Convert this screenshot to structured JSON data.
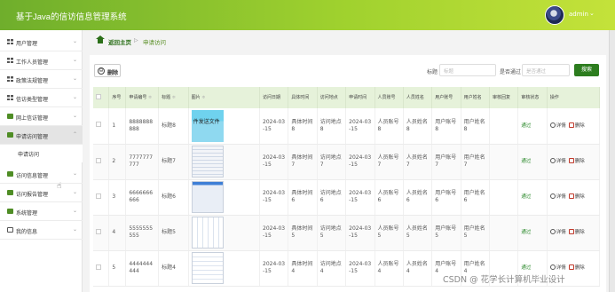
{
  "header": {
    "title": "基于Java的信访信息管理系统",
    "username": "admin",
    "user_caret": "⌄"
  },
  "sidebar": {
    "items": [
      {
        "label": "用户管理",
        "icon": "grid-icon"
      },
      {
        "label": "工作人员管理",
        "icon": "grid-icon"
      },
      {
        "label": "政策法规管理",
        "icon": "grid-icon"
      },
      {
        "label": "信访类型管理",
        "icon": "grid-icon"
      },
      {
        "label": "网上信访管理",
        "icon": "green-block-icon"
      },
      {
        "label": "申请访问管理",
        "icon": "green-block-icon",
        "expanded": true
      },
      {
        "label": "访问信息管理",
        "icon": "green-block-icon"
      },
      {
        "label": "访问报告管理",
        "icon": "green-block-icon"
      },
      {
        "label": "系统管理",
        "icon": "green-block-icon"
      },
      {
        "label": "我的信息",
        "icon": "page-icon"
      }
    ],
    "sub_item": "申请访问",
    "chevron_down": "⌄",
    "chevron_up": "⌃"
  },
  "breadcrumb": {
    "root": "返回主页",
    "separator": "▷",
    "current": "申请访问"
  },
  "toolbar": {
    "delete_label": "删除",
    "delete_icon": "⊖",
    "filter1_label": "标题",
    "filter1_placeholder": "标题",
    "filter2_label": "是否通过",
    "filter2_placeholder": "是否通过",
    "search_label": "搜索"
  },
  "table": {
    "columns": [
      "",
      "序号",
      "申请编号",
      "标题",
      "图片",
      "访问日期",
      "具体时间",
      "访问地点",
      "申请时间",
      "人员账号",
      "人员姓名",
      "用户账号",
      "用户姓名",
      "审核回复",
      "审核状态",
      "操作"
    ],
    "sort_mark": "≑",
    "rows": [
      {
        "index": "1",
        "code": "8888888888",
        "title": "标题8",
        "picture": "pic-1",
        "picture_text": "件发送文件",
        "date": "2024-03-15",
        "time": "具体时间8",
        "place": "访问地点8",
        "apply_time": "2024-03-15",
        "staff_account": "人员账号8",
        "staff_name": "人员姓名8",
        "user_account": "用户账号8",
        "user_name": "用户姓名8",
        "reply": "",
        "status": "通过"
      },
      {
        "index": "2",
        "code": "7777777777",
        "title": "标题7",
        "picture": "pic-2",
        "picture_text": "",
        "date": "2024-03-15",
        "time": "具体时间7",
        "place": "访问地点7",
        "apply_time": "2024-03-15",
        "staff_account": "人员账号7",
        "staff_name": "人员姓名7",
        "user_account": "用户账号7",
        "user_name": "用户姓名7",
        "reply": "",
        "status": "通过"
      },
      {
        "index": "3",
        "code": "6666666666",
        "title": "标题6",
        "picture": "pic-3",
        "picture_text": "",
        "date": "2024-03-15",
        "time": "具体时间6",
        "place": "访问地点6",
        "apply_time": "2024-03-15",
        "staff_account": "人员账号6",
        "staff_name": "人员姓名6",
        "user_account": "用户账号6",
        "user_name": "用户姓名6",
        "reply": "",
        "status": "通过"
      },
      {
        "index": "4",
        "code": "5555555555",
        "title": "标题5",
        "picture": "pic-4",
        "picture_text": "",
        "date": "2024-03-15",
        "time": "具体时间5",
        "place": "访问地点5",
        "apply_time": "2024-03-15",
        "staff_account": "人员账号5",
        "staff_name": "人员姓名5",
        "user_account": "用户账号5",
        "user_name": "用户姓名5",
        "reply": "",
        "status": "通过"
      },
      {
        "index": "5",
        "code": "4444444444",
        "title": "标题4",
        "picture": "pic-5",
        "picture_text": "",
        "date": "2024-03-15",
        "time": "具体时间4",
        "place": "访问地点4",
        "apply_time": "2024-03-15",
        "staff_account": "人员账号4",
        "staff_name": "人员姓名4",
        "user_account": "用户账号4",
        "user_name": "用户姓名4",
        "reply": "",
        "status": "通过"
      }
    ],
    "action_detail": "详情",
    "action_delete": "删除"
  },
  "watermark": "CSDN @ 花学长计算机毕业设计",
  "colors": {
    "header_start": "#6fae2c",
    "header_end": "#c4e23a",
    "accent": "#2b6f19",
    "search_button": "#2d7d1f",
    "status_pass": "#2e8b2e",
    "table_header": "#e6f2da"
  }
}
